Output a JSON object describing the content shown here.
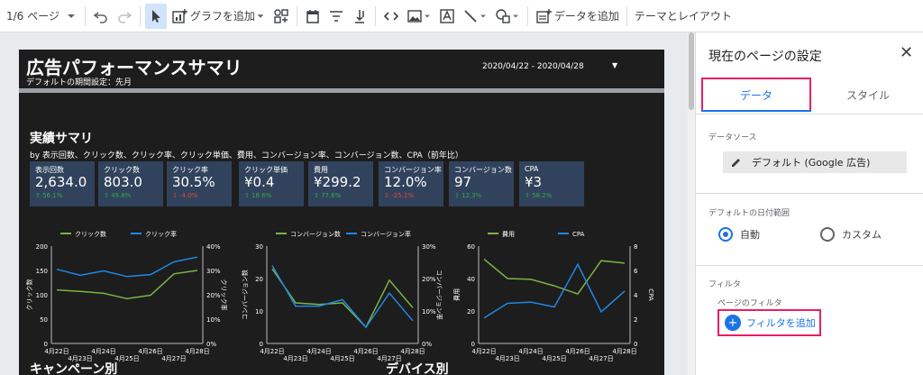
{
  "toolbar": {
    "page_indicator": "1/6 ページ",
    "add_chart": "グラフを追加",
    "add_data": "データを追加",
    "theme_layout": "テーマとレイアウト"
  },
  "report": {
    "title": "広告パフォーマンスサマリ",
    "subtitle": "デフォルトの期間設定：先月",
    "date_range": "2020/04/22 - 2020/04/28",
    "summary_title": "実績サマリ",
    "summary_sub": "by 表示回数、クリック数、クリック率、クリック単価、費用、コンバージョン率、コンバージョン数、CPA（前年比）",
    "campaign_title": "キャンペーン別",
    "device_title": "デバイス別",
    "scorecards": [
      {
        "label": "表示回数",
        "value": "2,634.0",
        "delta": "⇧ 56.1%",
        "dir": "up"
      },
      {
        "label": "クリック数",
        "value": "803.0",
        "delta": "⇧ 49.8%",
        "dir": "up"
      },
      {
        "label": "クリック率",
        "value": "30.5%",
        "delta": "⇩ -4.0%",
        "dir": "down"
      },
      {
        "label": "クリック単価",
        "value": "¥0.4",
        "delta": "⇧ 18.6%",
        "dir": "up"
      },
      {
        "label": "費用",
        "value": "¥299.2",
        "delta": "⇧ 77.6%",
        "dir": "up"
      },
      {
        "label": "コンバージョン率",
        "value": "12.0%",
        "delta": "⇩ -25.1%",
        "dir": "down"
      },
      {
        "label": "コンバージョン数",
        "value": "97",
        "delta": "⇧ 12.3%",
        "dir": "up"
      },
      {
        "label": "CPA",
        "value": "¥3",
        "delta": "⇧ 58.2%",
        "dir": "up"
      }
    ]
  },
  "chart_data": [
    {
      "type": "line",
      "x": [
        "4月22日",
        "4月23日",
        "4月24日",
        "4月25日",
        "4月26日",
        "4月27日",
        "4月28日"
      ],
      "series": [
        {
          "name": "クリック数",
          "axis": "left",
          "color": "#7cb342",
          "values": [
            110,
            107,
            103,
            92,
            99,
            143,
            150
          ]
        },
        {
          "name": "クリック率",
          "axis": "right",
          "color": "#1e88e5",
          "values": [
            30.5,
            28.0,
            29.8,
            27.5,
            28.3,
            33.5,
            35.5
          ]
        }
      ],
      "left_axis": {
        "label": "クリック数",
        "ticks": [
          "0",
          "50",
          "100",
          "150",
          "200"
        ],
        "min": 0,
        "max": 200
      },
      "right_axis": {
        "label": "クリック率",
        "ticks": [
          "0%",
          "10%",
          "20%",
          "30%",
          "40%"
        ],
        "min": 0,
        "max": 40
      }
    },
    {
      "type": "line",
      "x": [
        "4月22日",
        "4月23日",
        "4月24日",
        "4月25日",
        "4月26日",
        "4月27日",
        "4月28日"
      ],
      "series": [
        {
          "name": "コンバージョン数",
          "axis": "left",
          "color": "#7cb342",
          "values": [
            23,
            12.5,
            12,
            12.5,
            5,
            19.5,
            11
          ]
        },
        {
          "name": "コンバージョン率",
          "axis": "right",
          "color": "#1e88e5",
          "values": [
            24,
            11.5,
            11.5,
            13.5,
            5,
            15.5,
            7
          ]
        }
      ],
      "left_axis": {
        "label": "コンバージョン数",
        "ticks": [
          "0",
          "10",
          "20",
          "30"
        ],
        "min": 0,
        "max": 30
      },
      "right_axis": {
        "label": "コンバージョン率",
        "ticks": [
          "0%",
          "10%",
          "20%",
          "30%"
        ],
        "min": 0,
        "max": 30
      }
    },
    {
      "type": "line",
      "x": [
        "4月22日",
        "4月23日",
        "4月24日",
        "4月25日",
        "4月26日",
        "4月27日",
        "4月28日"
      ],
      "series": [
        {
          "name": "費用",
          "axis": "left",
          "color": "#7cb342",
          "values": [
            52,
            40,
            39.5,
            35.5,
            30.5,
            51,
            49.5
          ]
        },
        {
          "name": "CPA",
          "axis": "right",
          "color": "#1e88e5",
          "values": [
            2.1,
            3.3,
            3.4,
            3.0,
            6.5,
            2.6,
            4.3
          ]
        }
      ],
      "left_axis": {
        "label": "費用",
        "ticks": [
          "0",
          "20",
          "40",
          "60"
        ],
        "min": 0,
        "max": 60
      },
      "right_axis": {
        "label": "CPA",
        "ticks": [
          "0",
          "2",
          "4",
          "6",
          "8"
        ],
        "min": 0,
        "max": 8
      }
    }
  ],
  "panel": {
    "title": "現在のページの設定",
    "tab_data": "データ",
    "tab_style": "スタイル",
    "datasource_label": "データソース",
    "datasource_value": "デフォルト (Google 広告)",
    "date_range_label": "デフォルトの日付範囲",
    "radio_auto": "自動",
    "radio_custom": "カスタム",
    "filter_label": "フィルタ",
    "page_filter_label": "ページのフィルタ",
    "add_filter": "フィルタを追加"
  }
}
